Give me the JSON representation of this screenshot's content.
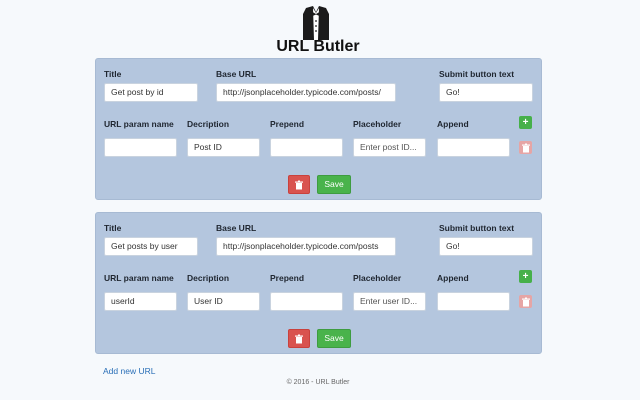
{
  "app": {
    "title": "URL Butler",
    "logo_icon": "butler-tuxedo-icon",
    "add_link_label": "Add new URL",
    "footer": "© 2016 - URL Butler"
  },
  "colors": {
    "card_bg": "#b4c6de",
    "save_green": "#49b34b",
    "delete_red": "#d9534f",
    "link_blue": "#2a6fb7"
  },
  "labels": {
    "title": "Title",
    "base_url": "Base URL",
    "submit_text": "Submit button text",
    "param_name": "URL param name",
    "description": "Decription",
    "prepend": "Prepend",
    "placeholder": "Placeholder",
    "append": "Append",
    "save": "Save"
  },
  "urls": [
    {
      "title": "Get post by id",
      "base_url": "http://jsonplaceholder.typicode.com/posts/",
      "submit_text": "Go!",
      "param": {
        "name": "",
        "description": "Post ID",
        "prepend": "",
        "placeholder": "Enter post ID...",
        "append": ""
      }
    },
    {
      "title": "Get posts by user",
      "base_url": "http://jsonplaceholder.typicode.com/posts",
      "submit_text": "Go!",
      "param": {
        "name": "userId",
        "description": "User ID",
        "prepend": "",
        "placeholder": "Enter user ID...",
        "append": ""
      }
    }
  ]
}
